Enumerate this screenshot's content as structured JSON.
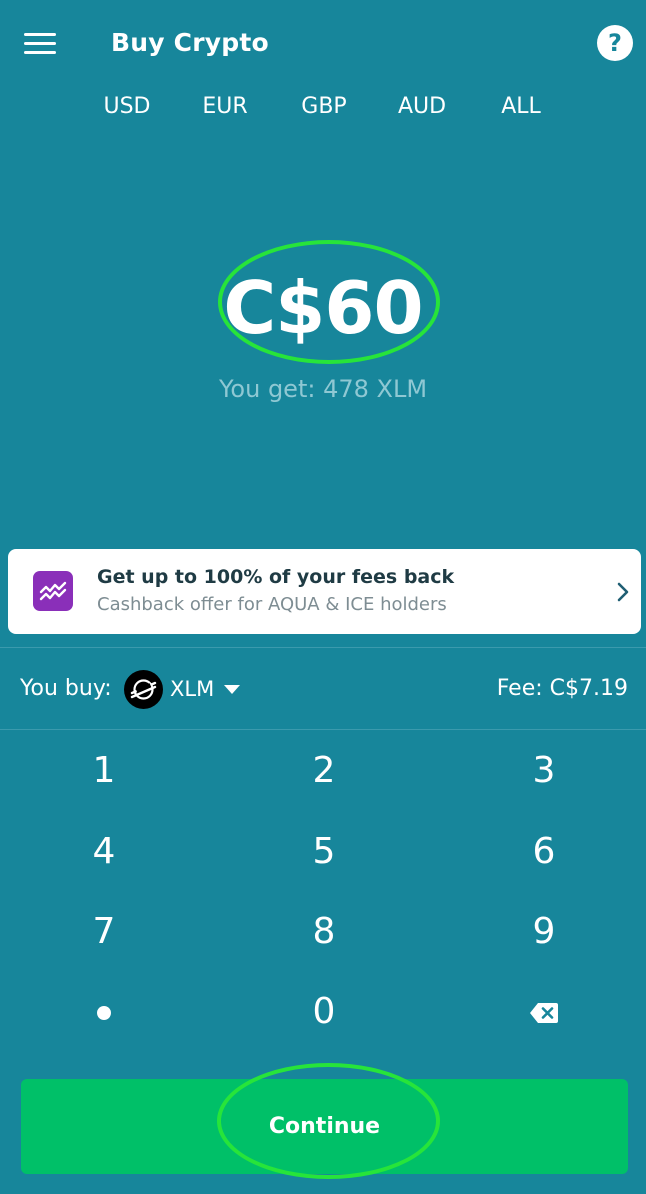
{
  "header": {
    "title": "Buy Crypto",
    "help_label": "?"
  },
  "currency_tabs": [
    "USD",
    "EUR",
    "GBP",
    "AUD",
    "ALL"
  ],
  "amount": {
    "value": "C$60",
    "you_get": "You get: 478 XLM"
  },
  "promo": {
    "title": "Get up to 100% of your fees back",
    "subtitle": "Cashback offer for AQUA & ICE holders"
  },
  "buy_row": {
    "label": "You buy:",
    "asset": "XLM",
    "fee": "Fee: C$7.19"
  },
  "keypad": {
    "keys": [
      "1",
      "2",
      "3",
      "4",
      "5",
      "6",
      "7",
      "8",
      "9",
      "0"
    ]
  },
  "continue_button": {
    "label": "Continue"
  },
  "colors": {
    "background": "#17869b",
    "continue_green": "#00c068",
    "highlight_green": "#27e43a",
    "promo_icon_purple": "#8a2fb9"
  }
}
